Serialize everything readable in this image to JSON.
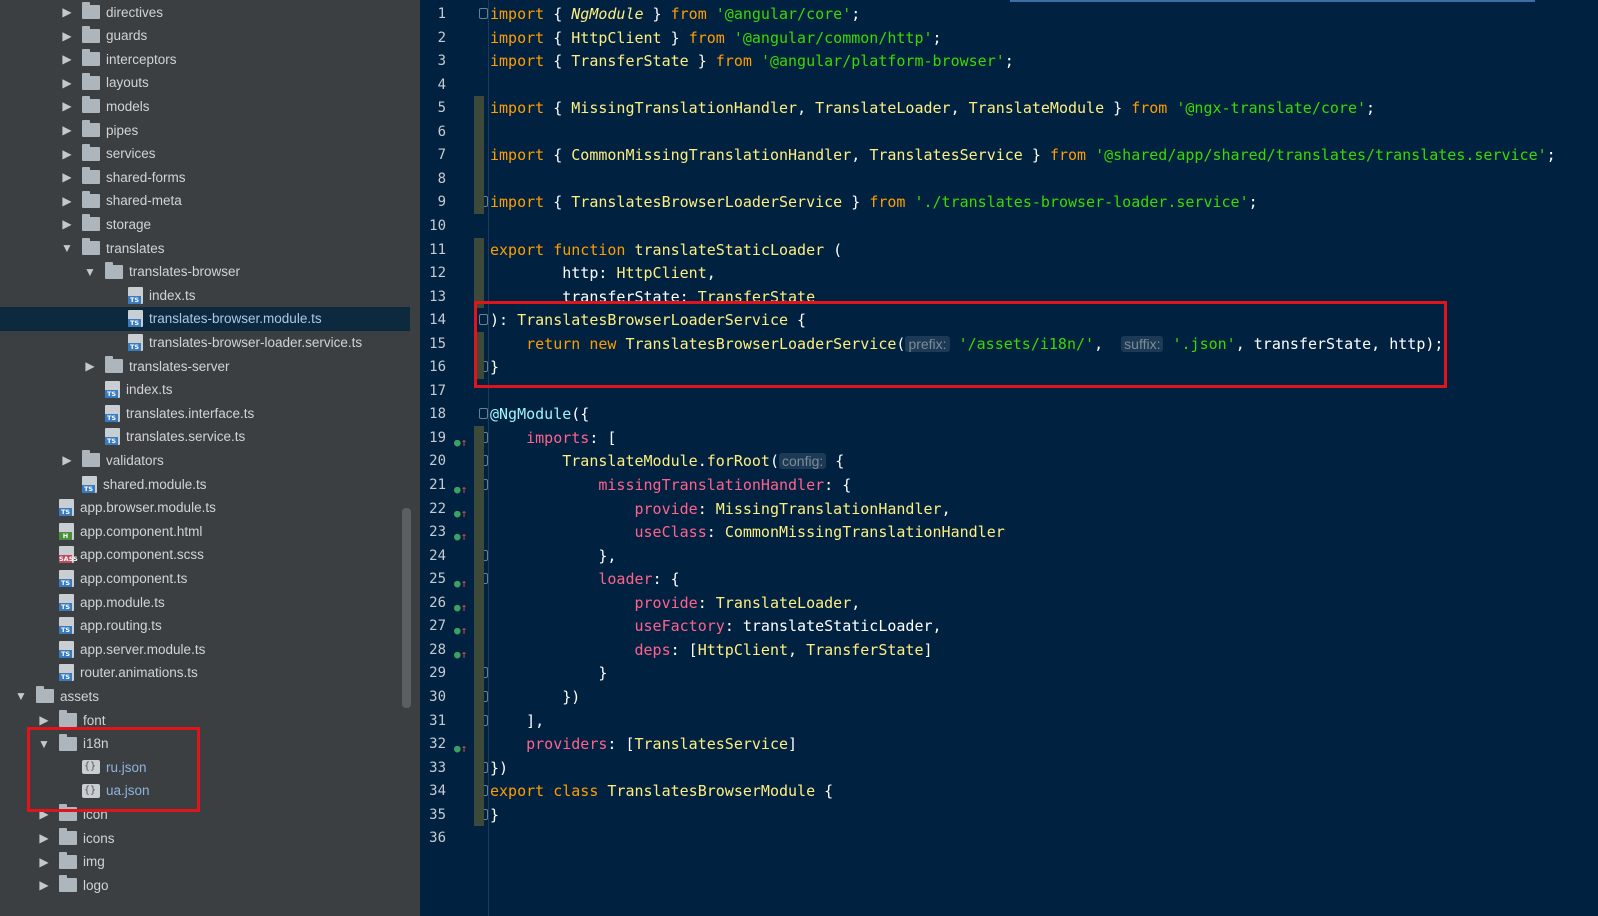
{
  "project_tree": {
    "items": [
      {
        "label": "directives",
        "type": "folder",
        "depth": 2,
        "arrow": "right"
      },
      {
        "label": "guards",
        "type": "folder",
        "depth": 2,
        "arrow": "right"
      },
      {
        "label": "interceptors",
        "type": "folder",
        "depth": 2,
        "arrow": "right"
      },
      {
        "label": "layouts",
        "type": "folder",
        "depth": 2,
        "arrow": "right"
      },
      {
        "label": "models",
        "type": "folder",
        "depth": 2,
        "arrow": "right"
      },
      {
        "label": "pipes",
        "type": "folder",
        "depth": 2,
        "arrow": "right"
      },
      {
        "label": "services",
        "type": "folder",
        "depth": 2,
        "arrow": "right"
      },
      {
        "label": "shared-forms",
        "type": "folder",
        "depth": 2,
        "arrow": "right"
      },
      {
        "label": "shared-meta",
        "type": "folder",
        "depth": 2,
        "arrow": "right"
      },
      {
        "label": "storage",
        "type": "folder",
        "depth": 2,
        "arrow": "right"
      },
      {
        "label": "translates",
        "type": "folder",
        "depth": 2,
        "arrow": "down"
      },
      {
        "label": "translates-browser",
        "type": "folder",
        "depth": 3,
        "arrow": "down"
      },
      {
        "label": "index.ts",
        "type": "ts",
        "depth": 4
      },
      {
        "label": "translates-browser.module.ts",
        "type": "ts",
        "depth": 4,
        "selected": true
      },
      {
        "label": "translates-browser-loader.service.ts",
        "type": "ts",
        "depth": 4
      },
      {
        "label": "translates-server",
        "type": "folder",
        "depth": 3,
        "arrow": "right"
      },
      {
        "label": "index.ts",
        "type": "ts",
        "depth": 3
      },
      {
        "label": "translates.interface.ts",
        "type": "ts",
        "depth": 3
      },
      {
        "label": "translates.service.ts",
        "type": "ts",
        "depth": 3
      },
      {
        "label": "validators",
        "type": "folder",
        "depth": 2,
        "arrow": "right"
      },
      {
        "label": "shared.module.ts",
        "type": "ts",
        "depth": 2
      },
      {
        "label": "app.browser.module.ts",
        "type": "ts",
        "depth": 1
      },
      {
        "label": "app.component.html",
        "type": "html",
        "depth": 1
      },
      {
        "label": "app.component.scss",
        "type": "scss",
        "depth": 1
      },
      {
        "label": "app.component.ts",
        "type": "ts",
        "depth": 1
      },
      {
        "label": "app.module.ts",
        "type": "ts",
        "depth": 1
      },
      {
        "label": "app.routing.ts",
        "type": "ts",
        "depth": 1
      },
      {
        "label": "app.server.module.ts",
        "type": "ts",
        "depth": 1
      },
      {
        "label": "router.animations.ts",
        "type": "ts",
        "depth": 1
      },
      {
        "label": "assets",
        "type": "folder",
        "depth": 0,
        "arrow": "down"
      },
      {
        "label": "font",
        "type": "folder",
        "depth": 1,
        "arrow": "right"
      },
      {
        "label": "i18n",
        "type": "folder",
        "depth": 1,
        "arrow": "down"
      },
      {
        "label": "ru.json",
        "type": "json",
        "depth": 2,
        "link": true
      },
      {
        "label": "ua.json",
        "type": "json",
        "depth": 2,
        "link": true
      },
      {
        "label": "icon",
        "type": "folder",
        "depth": 1,
        "arrow": "right"
      },
      {
        "label": "icons",
        "type": "folder",
        "depth": 1,
        "arrow": "right"
      },
      {
        "label": "img",
        "type": "folder",
        "depth": 1,
        "arrow": "right"
      },
      {
        "label": "logo",
        "type": "folder",
        "depth": 1,
        "arrow": "right"
      }
    ]
  },
  "file_badges": {
    "ts": "TS",
    "html": "H",
    "scss": "SASS"
  },
  "editor": {
    "lines": [
      {
        "n": "1",
        "gutter": "",
        "tokens": [
          [
            "kw",
            "import"
          ],
          [
            "pu",
            " { "
          ],
          [
            "it",
            "NgModule"
          ],
          [
            "pu",
            " } "
          ],
          [
            "kw",
            "from"
          ],
          [
            "pu",
            " "
          ],
          [
            "str",
            "'@angular/core'"
          ],
          [
            "pu",
            ";"
          ]
        ]
      },
      {
        "n": "2",
        "gutter": "",
        "tokens": [
          [
            "kw",
            "import"
          ],
          [
            "pu",
            " { "
          ],
          [
            "ty",
            "HttpClient"
          ],
          [
            "pu",
            " } "
          ],
          [
            "kw",
            "from"
          ],
          [
            "pu",
            " "
          ],
          [
            "str",
            "'@angular/common/http'"
          ],
          [
            "pu",
            ";"
          ]
        ]
      },
      {
        "n": "3",
        "gutter": "",
        "tokens": [
          [
            "kw",
            "import"
          ],
          [
            "pu",
            " { "
          ],
          [
            "ty",
            "TransferState"
          ],
          [
            "pu",
            " } "
          ],
          [
            "kw",
            "from"
          ],
          [
            "pu",
            " "
          ],
          [
            "str",
            "'@angular/platform-browser'"
          ],
          [
            "pu",
            ";"
          ]
        ]
      },
      {
        "n": "4",
        "gutter": "",
        "tokens": []
      },
      {
        "n": "5",
        "gutter": "",
        "tokens": [
          [
            "kw",
            "import"
          ],
          [
            "pu",
            " { "
          ],
          [
            "ty",
            "MissingTranslationHandler"
          ],
          [
            "pu",
            ", "
          ],
          [
            "ty",
            "TranslateLoader"
          ],
          [
            "pu",
            ", "
          ],
          [
            "ty",
            "TranslateModule"
          ],
          [
            "pu",
            " } "
          ],
          [
            "kw",
            "from"
          ],
          [
            "pu",
            " "
          ],
          [
            "str",
            "'@ngx-translate/core'"
          ],
          [
            "pu",
            ";"
          ]
        ]
      },
      {
        "n": "6",
        "gutter": "",
        "tokens": []
      },
      {
        "n": "7",
        "gutter": "",
        "tokens": [
          [
            "kw",
            "import"
          ],
          [
            "pu",
            " { "
          ],
          [
            "ty",
            "CommonMissingTranslationHandler"
          ],
          [
            "pu",
            ", "
          ],
          [
            "ty",
            "TranslatesService"
          ],
          [
            "pu",
            " } "
          ],
          [
            "kw",
            "from"
          ],
          [
            "pu",
            " "
          ],
          [
            "str",
            "'@shared/app/shared/translates/translates.service'"
          ],
          [
            "pu",
            ";"
          ]
        ]
      },
      {
        "n": "8",
        "gutter": "",
        "tokens": []
      },
      {
        "n": "9",
        "gutter": "",
        "tokens": [
          [
            "kw",
            "import"
          ],
          [
            "pu",
            " { "
          ],
          [
            "ty",
            "TranslatesBrowserLoaderService"
          ],
          [
            "pu",
            " } "
          ],
          [
            "kw",
            "from"
          ],
          [
            "pu",
            " "
          ],
          [
            "str",
            "'./translates-browser-loader.service'"
          ],
          [
            "pu",
            ";"
          ]
        ]
      },
      {
        "n": "10",
        "gutter": "",
        "tokens": []
      },
      {
        "n": "11",
        "gutter": "",
        "tokens": [
          [
            "kw",
            "export"
          ],
          [
            "pu",
            " "
          ],
          [
            "kw",
            "function"
          ],
          [
            "pu",
            " "
          ],
          [
            "fn",
            "translateStaticLoader"
          ],
          [
            "pu",
            " ("
          ]
        ]
      },
      {
        "n": "12",
        "gutter": "",
        "tokens": [
          [
            "pu",
            "        http: "
          ],
          [
            "ty",
            "HttpClient"
          ],
          [
            "pu",
            ","
          ]
        ]
      },
      {
        "n": "13",
        "gutter": "",
        "tokens": [
          [
            "pu",
            "        transferState: "
          ],
          [
            "ty",
            "TransferState"
          ]
        ]
      },
      {
        "n": "14",
        "gutter": "",
        "tokens": [
          [
            "pu",
            "): "
          ],
          [
            "ty",
            "TranslatesBrowserLoaderService"
          ],
          [
            "pu",
            " {"
          ]
        ]
      },
      {
        "n": "15",
        "gutter": "",
        "tokens": [
          [
            "pu",
            "    "
          ],
          [
            "kw",
            "return"
          ],
          [
            "pu",
            " "
          ],
          [
            "kw",
            "new"
          ],
          [
            "pu",
            " "
          ],
          [
            "ty",
            "TranslatesBrowserLoaderService"
          ],
          [
            "pu",
            "("
          ],
          [
            "hint",
            "prefix:"
          ],
          [
            "pu",
            " "
          ],
          [
            "str",
            "'/assets/i18n/'"
          ],
          [
            "pu",
            ",  "
          ],
          [
            "hint",
            "suffix:"
          ],
          [
            "pu",
            " "
          ],
          [
            "str",
            "'.json'"
          ],
          [
            "pu",
            ", transferState, http);"
          ]
        ]
      },
      {
        "n": "16",
        "gutter": "",
        "tokens": [
          [
            "pu",
            "}"
          ]
        ]
      },
      {
        "n": "17",
        "gutter": "",
        "tokens": []
      },
      {
        "n": "18",
        "gutter": "",
        "tokens": [
          [
            "dec",
            "@NgModule"
          ],
          [
            "pu",
            "({"
          ]
        ]
      },
      {
        "n": "19",
        "gutter": "o↑",
        "tokens": [
          [
            "pu",
            "    "
          ],
          [
            "prop",
            "imports"
          ],
          [
            "pu",
            ": ["
          ]
        ]
      },
      {
        "n": "20",
        "gutter": "",
        "tokens": [
          [
            "pu",
            "        "
          ],
          [
            "ty",
            "TranslateModule"
          ],
          [
            "pu",
            "."
          ],
          [
            "fn",
            "forRoot"
          ],
          [
            "pu",
            "("
          ],
          [
            "hint",
            "config:"
          ],
          [
            "pu",
            " {"
          ]
        ]
      },
      {
        "n": "21",
        "gutter": "o↑",
        "tokens": [
          [
            "pu",
            "            "
          ],
          [
            "prop",
            "missingTranslationHandler"
          ],
          [
            "pu",
            ": {"
          ]
        ]
      },
      {
        "n": "22",
        "gutter": "o↑",
        "tokens": [
          [
            "pu",
            "                "
          ],
          [
            "prop",
            "provide"
          ],
          [
            "pu",
            ": "
          ],
          [
            "ty",
            "MissingTranslationHandler"
          ],
          [
            "pu",
            ","
          ]
        ]
      },
      {
        "n": "23",
        "gutter": "o↑",
        "tokens": [
          [
            "pu",
            "                "
          ],
          [
            "prop",
            "useClass"
          ],
          [
            "pu",
            ": "
          ],
          [
            "ty",
            "CommonMissingTranslationHandler"
          ]
        ]
      },
      {
        "n": "24",
        "gutter": "",
        "tokens": [
          [
            "pu",
            "            },"
          ]
        ]
      },
      {
        "n": "25",
        "gutter": "o↑",
        "tokens": [
          [
            "pu",
            "            "
          ],
          [
            "prop",
            "loader"
          ],
          [
            "pu",
            ": {"
          ]
        ]
      },
      {
        "n": "26",
        "gutter": "o↑",
        "tokens": [
          [
            "pu",
            "                "
          ],
          [
            "prop",
            "provide"
          ],
          [
            "pu",
            ": "
          ],
          [
            "ty",
            "TranslateLoader"
          ],
          [
            "pu",
            ","
          ]
        ]
      },
      {
        "n": "27",
        "gutter": "o↑",
        "tokens": [
          [
            "pu",
            "                "
          ],
          [
            "prop",
            "useFactory"
          ],
          [
            "pu",
            ": translateStaticLoader,"
          ]
        ]
      },
      {
        "n": "28",
        "gutter": "o↑",
        "tokens": [
          [
            "pu",
            "                "
          ],
          [
            "prop",
            "deps"
          ],
          [
            "pu",
            ": ["
          ],
          [
            "ty",
            "HttpClient"
          ],
          [
            "pu",
            ", "
          ],
          [
            "ty",
            "TransferState"
          ],
          [
            "pu",
            "]"
          ]
        ]
      },
      {
        "n": "29",
        "gutter": "",
        "tokens": [
          [
            "pu",
            "            }"
          ]
        ]
      },
      {
        "n": "30",
        "gutter": "",
        "tokens": [
          [
            "pu",
            "        })"
          ]
        ]
      },
      {
        "n": "31",
        "gutter": "",
        "tokens": [
          [
            "pu",
            "    ],"
          ]
        ]
      },
      {
        "n": "32",
        "gutter": "o↑",
        "tokens": [
          [
            "pu",
            "    "
          ],
          [
            "prop",
            "providers"
          ],
          [
            "pu",
            ": ["
          ],
          [
            "ty",
            "TranslatesService"
          ],
          [
            "pu",
            "]"
          ]
        ]
      },
      {
        "n": "33",
        "gutter": "",
        "tokens": [
          [
            "pu",
            "})"
          ]
        ]
      },
      {
        "n": "34",
        "gutter": "",
        "tokens": [
          [
            "kw",
            "export"
          ],
          [
            "pu",
            " "
          ],
          [
            "kw",
            "class"
          ],
          [
            "pu",
            " "
          ],
          [
            "ty",
            "TranslatesBrowserModule"
          ],
          [
            "pu",
            " {"
          ]
        ]
      },
      {
        "n": "35",
        "gutter": "",
        "tokens": [
          [
            "pu",
            "}"
          ]
        ]
      },
      {
        "n": "36",
        "gutter": "",
        "tokens": []
      }
    ]
  },
  "colors": {
    "editor_bg": "#002240",
    "sidebar_bg": "#3c3f41",
    "keyword": "#ff9d00",
    "string": "#3ad900",
    "type": "#ffee80",
    "annotation_box": "#e0141b"
  },
  "icons": [
    "chevron-right-icon",
    "chevron-down-icon",
    "folder-icon",
    "typescript-file-icon",
    "html-file-icon",
    "scss-file-icon",
    "json-file-icon",
    "implements-marker-icon",
    "fold-icon"
  ]
}
